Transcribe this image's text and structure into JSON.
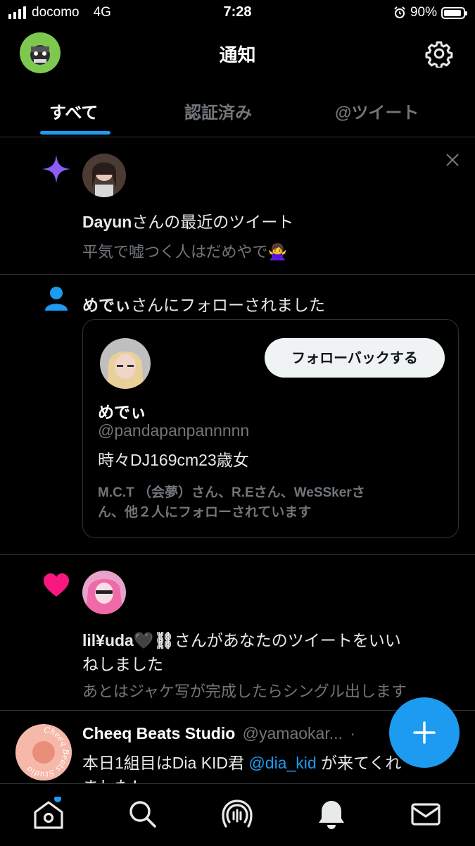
{
  "status_bar": {
    "carrier": "docomo",
    "network": "4G",
    "time": "7:28",
    "battery": "90%"
  },
  "header": {
    "title": "通知"
  },
  "tabs": [
    {
      "label": "すべて",
      "active": true
    },
    {
      "label": "認証済み",
      "active": false
    },
    {
      "label": "@ツイート",
      "active": false
    }
  ],
  "notifications": {
    "recent_tweet": {
      "icon": "sparkle-icon",
      "title_user": "Dayun",
      "title_rest": "さんの最近のツイート",
      "body": "平気で嘘つく人はだめやで🙅‍♀️"
    },
    "follow": {
      "icon": "person-icon",
      "user": "めでぃ",
      "text_rest": "さんにフォローされました",
      "card": {
        "name": "めでぃ",
        "handle": "@pandapanpannnnn",
        "bio": "時々DJ169cm23歳女",
        "followed_by_line1": "M.C.T （会夢）さん、R.Eさん、WeSSkerさ",
        "followed_by_line2": "ん、他２人にフォローされています",
        "follow_back_label": "フォローバックする"
      }
    },
    "like": {
      "icon": "heart-icon",
      "user": "lil¥uda🖤⛓",
      "text_line1_rest": "さんがあなたのツイートをいい",
      "text_line2": "ねしました",
      "quoted": "あとはジャケ写が完成したらシングル出します"
    },
    "tweet": {
      "name": "Cheeq Beats Studio",
      "handle": "@yamaokar...",
      "dot": "·",
      "text_line1_a": "本日1組目はDia KID君 ",
      "mention": "@dia_kid",
      "text_line1_b": " が来てくれ",
      "text_line2": "ました！",
      "avatar_text": "Cheeq Beats Studio"
    }
  },
  "colors": {
    "accent": "#1d9bf0",
    "heart": "#f91880",
    "sparkle": "#8b5cf6",
    "background": "#000000"
  },
  "navbar": {
    "items": [
      "home-icon",
      "search-icon",
      "spaces-icon",
      "bell-icon",
      "mail-icon"
    ],
    "active": "home-icon"
  }
}
